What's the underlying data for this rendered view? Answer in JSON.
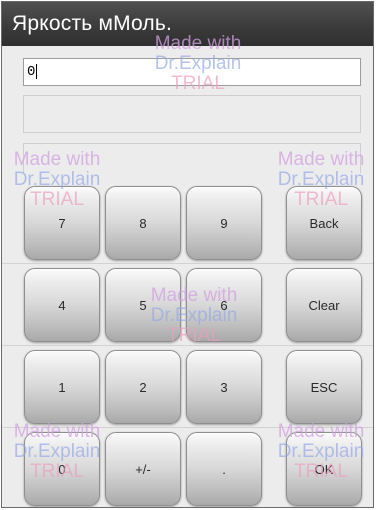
{
  "window": {
    "title": "Яркость мМоль."
  },
  "fields": {
    "main_value": "0",
    "secondary_value": "",
    "tertiary_value": ""
  },
  "keypad": {
    "keys": [
      "7",
      "8",
      "9",
      "Back",
      "4",
      "5",
      "6",
      "Clear",
      "1",
      "2",
      "3",
      "ESC",
      "0",
      "+/-",
      ".",
      "OK"
    ]
  },
  "watermark": {
    "line1": "Made with",
    "line2": "Dr.Explain",
    "line3": "TRIAL"
  }
}
